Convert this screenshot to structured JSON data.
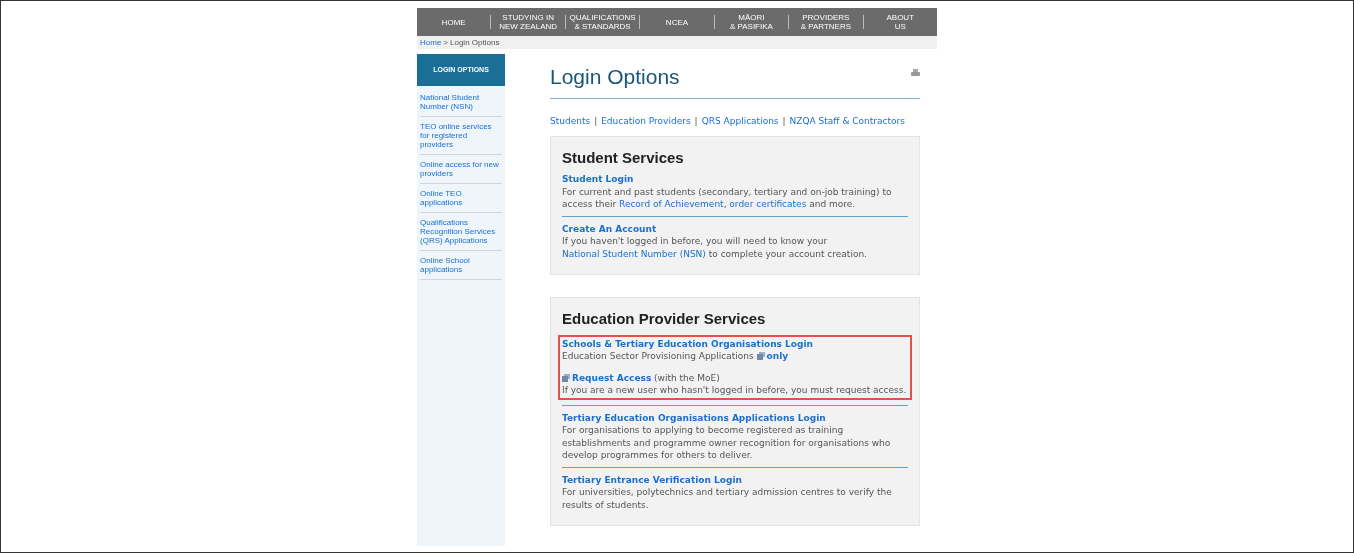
{
  "nav": [
    {
      "label": "HOME"
    },
    {
      "label": "STUDYING IN\nNEW ZEALAND"
    },
    {
      "label": "QUALIFICATIONS\n& STANDARDS"
    },
    {
      "label": "NCEA"
    },
    {
      "label": "MĀORI\n& PASIFIKA"
    },
    {
      "label": "PROVIDERS\n& PARTNERS"
    },
    {
      "label": "ABOUT\nUS"
    }
  ],
  "breadcrumb": {
    "home": "Home",
    "separator": ">",
    "current": "Login Options"
  },
  "sidebar": {
    "title": "LOGIN OPTIONS",
    "items": [
      "National Student Number (NSN)",
      "TEO online services for registered providers",
      "Online access for new providers",
      "Online TEO applications",
      "Qualifications Recognition Services (QRS) Applications",
      "Online School applications"
    ]
  },
  "page_title": "Login Options",
  "anchor_links": [
    "Students",
    "Education Providers",
    "QRS Applications",
    "NZQA Staff & Contractors"
  ],
  "anchor_separator": "|",
  "sections": [
    {
      "heading": "Student Services",
      "groups": [
        {
          "highlighted": false,
          "entries": [
            {
              "title": [
                {
                  "kind": "link",
                  "text": "Student Login"
                }
              ],
              "description": [
                {
                  "kind": "text",
                  "text": "For current and past students (secondary, tertiary and on-job training) to access their "
                },
                {
                  "kind": "link",
                  "text": "Record of Achievement"
                },
                {
                  "kind": "text",
                  "text": ", "
                },
                {
                  "kind": "link",
                  "text": "order certificates"
                },
                {
                  "kind": "text",
                  "text": " and more."
                }
              ]
            }
          ]
        },
        {
          "highlighted": false,
          "entries": [
            {
              "title": [
                {
                  "kind": "link",
                  "text": "Create An Account"
                }
              ],
              "description": [
                {
                  "kind": "text",
                  "text": "If you haven't logged in before, you will need to know your "
                },
                {
                  "kind": "link",
                  "text": "National Student Number (NSN)"
                },
                {
                  "kind": "text",
                  "text": " to complete your account creation."
                }
              ]
            }
          ]
        }
      ]
    },
    {
      "heading": "Education Provider Services",
      "groups": [
        {
          "highlighted": true,
          "entries": [
            {
              "title": [
                {
                  "kind": "link",
                  "text": "Schools & Tertiary Education Organisations Login"
                }
              ],
              "description": [
                {
                  "kind": "text",
                  "text": "Education Sector Provisioning Applications "
                },
                {
                  "kind": "icon"
                },
                {
                  "kind": "bold-link",
                  "text": "only"
                }
              ]
            },
            {
              "title": [
                {
                  "kind": "icon"
                },
                {
                  "kind": "link",
                  "text": "Request Access"
                },
                {
                  "kind": "text",
                  "text": " (with the MoE)"
                }
              ],
              "description": [
                {
                  "kind": "text",
                  "text": "If you are a new user who hasn't logged in before, you must request access."
                }
              ]
            }
          ]
        },
        {
          "highlighted": false,
          "entries": [
            {
              "title": [
                {
                  "kind": "link",
                  "text": "Tertiary Education Organisations Applications Login"
                }
              ],
              "description": [
                {
                  "kind": "text",
                  "text": "For organisations to applying to become registered as training establishments and programme owner recognition for organisations who develop programmes for others to deliver."
                }
              ]
            }
          ]
        },
        {
          "highlighted": false,
          "entries": [
            {
              "title": [
                {
                  "kind": "link",
                  "text": "Tertiary Entrance Verification Login"
                }
              ],
              "description": [
                {
                  "kind": "text",
                  "text": "For universities, polytechnics and tertiary admission centres to verify the results of students."
                }
              ]
            }
          ]
        }
      ]
    }
  ]
}
